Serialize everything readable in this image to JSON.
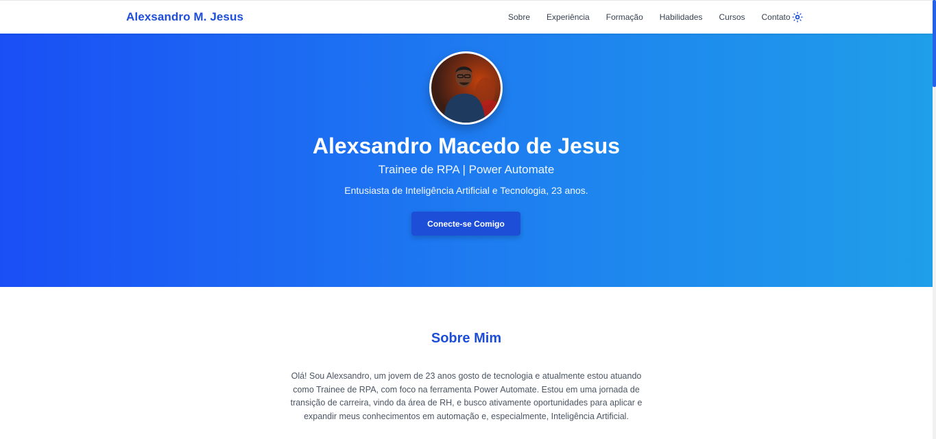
{
  "nav": {
    "brand": "Alexsandro M. Jesus",
    "links": [
      "Sobre",
      "Experiência",
      "Formação",
      "Habilidades",
      "Cursos",
      "Contato"
    ],
    "theme_icon": "gear-sun-icon"
  },
  "hero": {
    "name": "Alexsandro Macedo de Jesus",
    "role": "Trainee de RPA | Power Automate",
    "tagline": "Entusiasta de Inteligência Artificial e Tecnologia, 23 anos.",
    "cta_label": "Conecte-se Comigo",
    "avatar_icon": "profile-photo"
  },
  "about": {
    "title": "Sobre Mim",
    "text": "Olá! Sou Alexsandro, um jovem de 23 anos gosto de tecnologia e atualmente estou atuando como Trainee de RPA, com foco na ferramenta Power Automate. Estou em uma jornada de transição de carreira, vindo da área de RH, e busco ativamente oportunidades para aplicar e expandir meus conhecimentos em automação e, especialmente, Inteligência Artificial."
  },
  "colors": {
    "accent": "#1d4ed8",
    "hero_start": "#1a4ff5",
    "hero_end": "#1f9ee9"
  }
}
